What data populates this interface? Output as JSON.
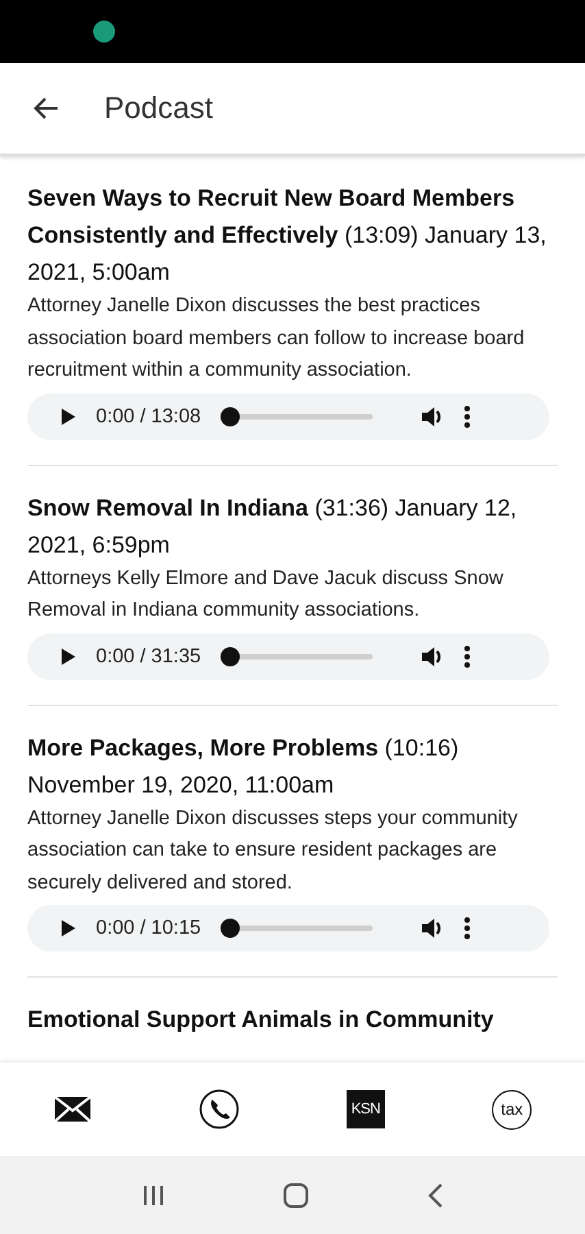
{
  "app_bar": {
    "title": "Podcast"
  },
  "episodes": [
    {
      "heading": "**Seven Ways to Recruit New Board Members Consistently and Effectively** (13:09) January 13, 2021, 5:00am",
      "description": "Attorney Janelle Dixon discusses the best practices association board members can follow to increase board recruitment within a community association.",
      "player": {
        "time": "0:00 / 13:08",
        "level": 0
      }
    },
    {
      "heading": "**Snow Removal In Indiana** (31:36) January 12, 2021, 6:59pm",
      "description": "Attorneys Kelly Elmore and Dave Jacuk discuss Snow Removal in Indiana community associations.",
      "player": {
        "time": "0:00 / 31:35",
        "level": 0
      }
    },
    {
      "heading": "**More Packages, More Problems** (10:16) November 19, 2020, 11:00am",
      "description": "Attorney Janelle Dixon discusses steps your community association can take to ensure resident packages are securely delivered and stored.",
      "player": {
        "time": "0:00 / 10:15",
        "level": 0
      }
    },
    {
      "heading": "**Emotional Support Animals in Community**"
    }
  ],
  "bottom_nav": [
    {
      "kind": "mail"
    },
    {
      "kind": "phone"
    },
    {
      "kind": "logo",
      "label": "KSN"
    },
    {
      "kind": "badge",
      "label": "tax"
    }
  ]
}
